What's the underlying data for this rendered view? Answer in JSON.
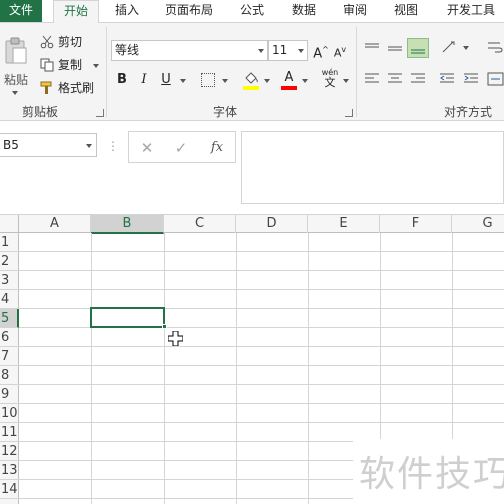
{
  "tabs": [
    {
      "id": "file",
      "label": "文件"
    },
    {
      "id": "home",
      "label": "开始"
    },
    {
      "id": "insert",
      "label": "插入"
    },
    {
      "id": "layout",
      "label": "页面布局"
    },
    {
      "id": "formulas",
      "label": "公式"
    },
    {
      "id": "data",
      "label": "数据"
    },
    {
      "id": "review",
      "label": "审阅"
    },
    {
      "id": "view",
      "label": "视图"
    },
    {
      "id": "developer",
      "label": "开发工具"
    }
  ],
  "active_tab": "开始",
  "clipboard": {
    "paste_label": "粘贴",
    "cut_label": "剪切",
    "copy_label": "复制",
    "format_painter_label": "格式刷",
    "group_label": "剪贴板"
  },
  "font": {
    "font_name": "等线",
    "font_size": "11",
    "bold": "B",
    "italic": "I",
    "underline": "U",
    "grow": "A",
    "shrink": "A",
    "font_color_letter": "A",
    "phonetic_top": "wén",
    "phonetic_bottom": "文",
    "group_label": "字体",
    "fill_color": "#ffff00",
    "font_color": "#ff0000"
  },
  "alignment": {
    "group_label": "对齐方式"
  },
  "formula_bar": {
    "name_box": "B5",
    "cancel_icon": "✕",
    "enter_icon": "✓",
    "fx_label": "fx",
    "formula_value": ""
  },
  "grid": {
    "columns": [
      "A",
      "B",
      "C",
      "D",
      "E",
      "F",
      "G"
    ],
    "rows": [
      "1",
      "2",
      "3",
      "4",
      "5",
      "6",
      "7",
      "8",
      "9",
      "10",
      "11",
      "12",
      "13",
      "14"
    ],
    "selected_cell": "B5",
    "selected_column": "B",
    "selected_row": "5"
  },
  "watermark": "软件技巧",
  "colors": {
    "accent": "#217346",
    "ribbon_bg": "#f4f4f4",
    "grid_line": "#d4d4d4"
  }
}
